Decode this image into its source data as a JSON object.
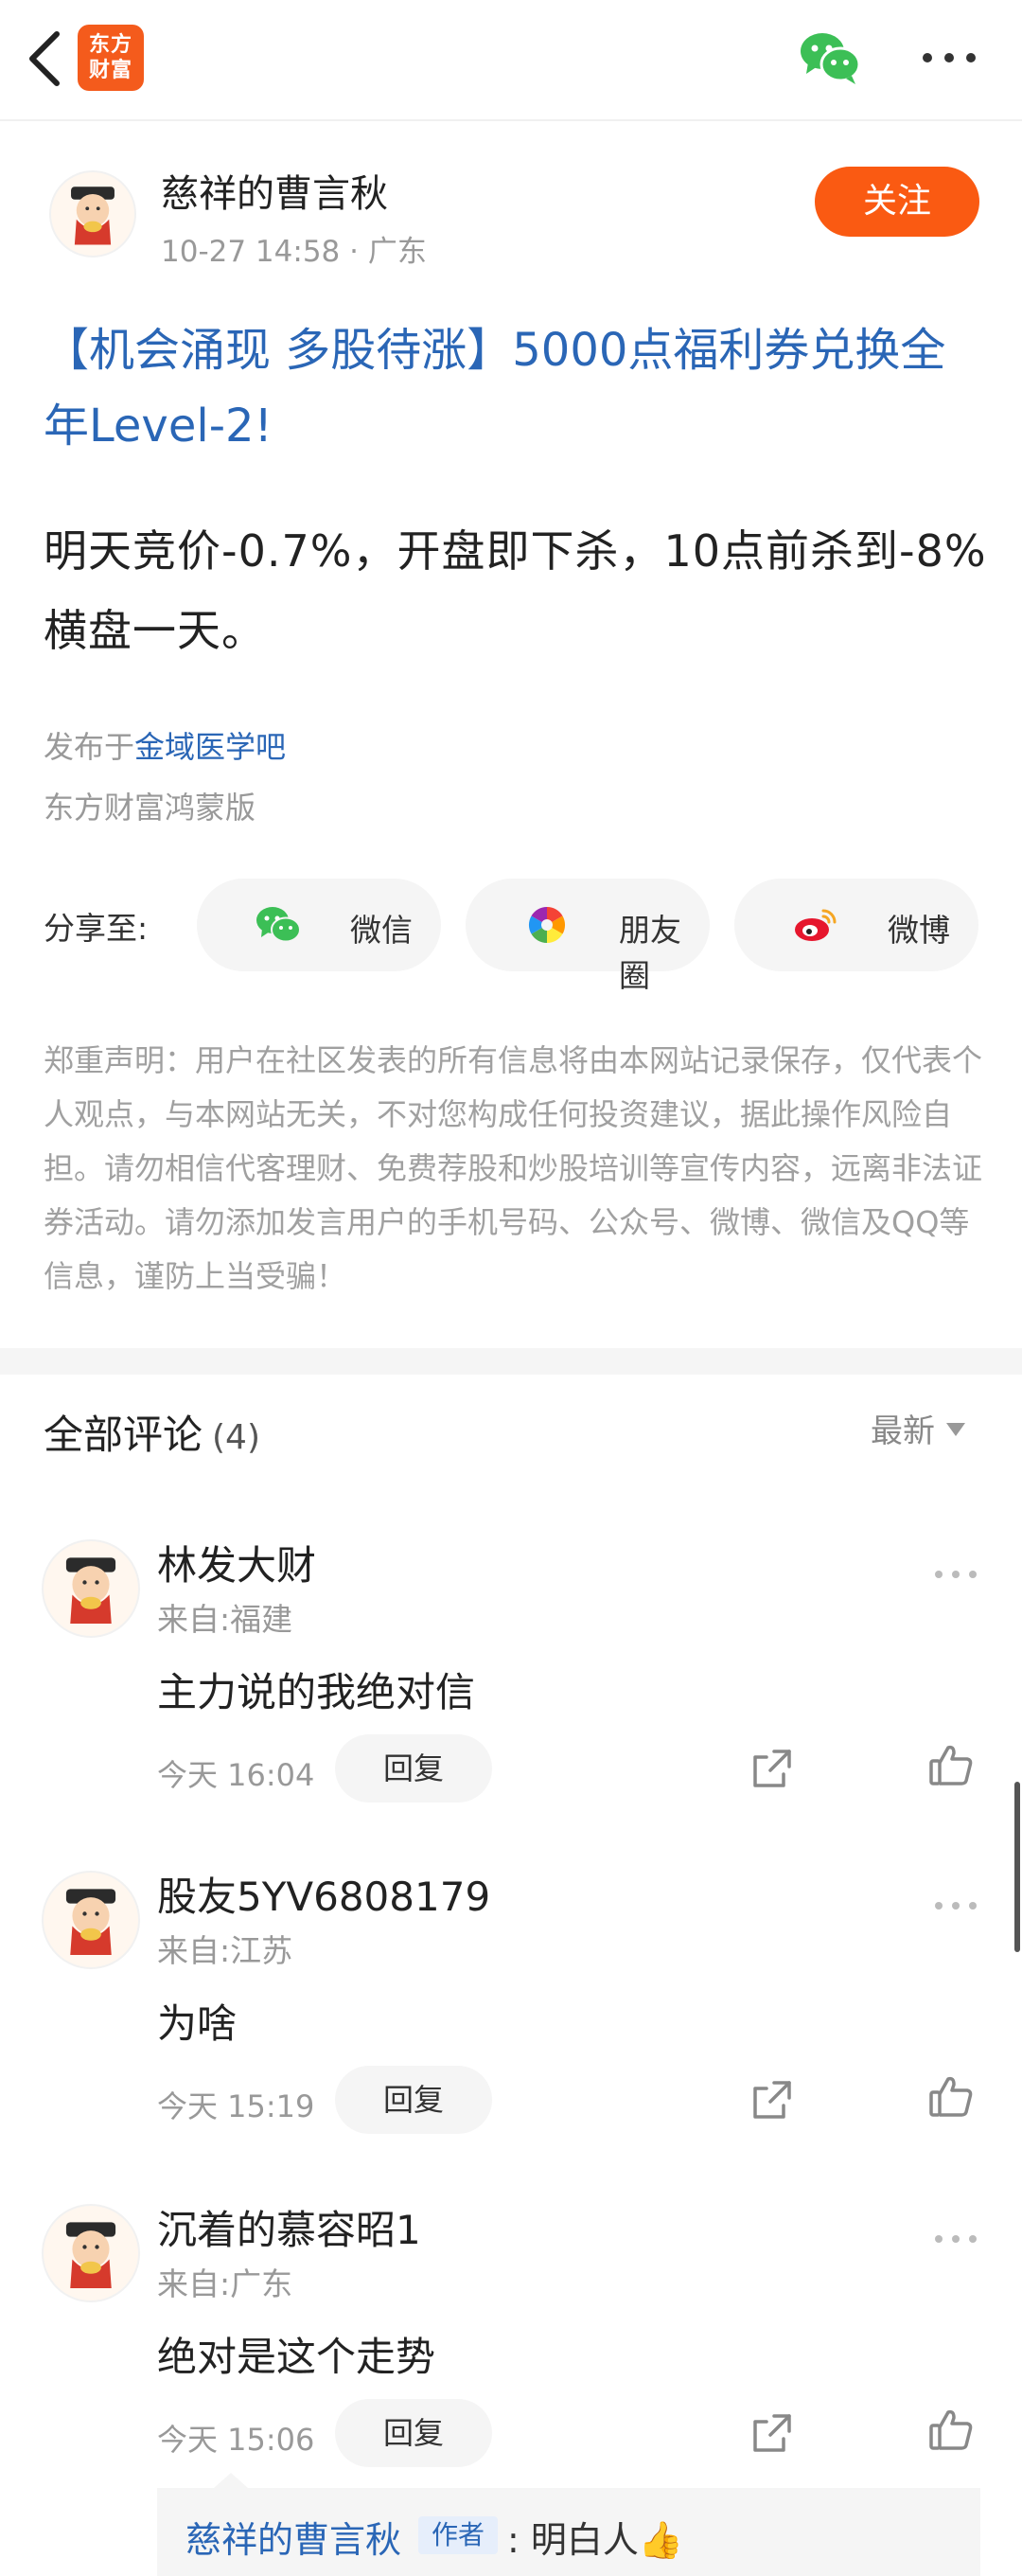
{
  "app": {
    "logo_line1": "东方",
    "logo_line2": "财富",
    "icons": {
      "back": "back-chevron-icon",
      "wechat": "wechat-icon",
      "more": "more-dots-icon"
    }
  },
  "post": {
    "author_name": "慈祥的曹言秋",
    "time": "10-27 14:58",
    "location": "广东",
    "meta_sep": " · ",
    "follow_label": "关注",
    "title": "【机会涌现 多股待涨】5000点福利券兑换全年Level-2!",
    "body": "明天竞价-0.7%，开盘即下杀，10点前杀到-8%横盘一天。",
    "published_prefix": "发布于",
    "bar_name": "金域医学吧",
    "client": "东方财富鸿蒙版"
  },
  "share": {
    "label": "分享至:",
    "targets": [
      {
        "label": "微信",
        "icon": "wechat-icon"
      },
      {
        "label": "朋友圈",
        "icon": "moments-icon"
      },
      {
        "label": "微博",
        "icon": "weibo-icon"
      }
    ]
  },
  "disclaimer": "郑重声明：用户在社区发表的所有信息将由本网站记录保存，仅代表个人观点，与本网站无关，不对您构成任何投资建议，据此操作风险自担。请勿相信代客理财、免费荐股和炒股培训等宣传内容，远离非法证券活动。请勿添加发言用户的手机号码、公众号、微博、微信及QQ等信息，谨防上当受骗！",
  "comments": {
    "title": "全部评论",
    "count": "(4)",
    "sort_label": "最新",
    "reply_label": "回复",
    "items": [
      {
        "name": "林发大财",
        "from": "来自:福建",
        "text": "主力说的我绝对信",
        "time": "今天 16:04"
      },
      {
        "name": "股友5YV6808179",
        "from": "来自:江苏",
        "text": "为啥",
        "time": "今天 15:19"
      },
      {
        "name": "沉着的慕容昭1",
        "from": "来自:广东",
        "text": "绝对是这个走势",
        "time": "今天 15:06"
      }
    ],
    "author_reply": {
      "name": "慈祥的曹言秋",
      "badge": "作者",
      "text": ": 明白人👍"
    }
  },
  "colors": {
    "accent_orange": "#fa5a12",
    "link_blue": "#2a66b6",
    "muted_gray": "#999999"
  }
}
